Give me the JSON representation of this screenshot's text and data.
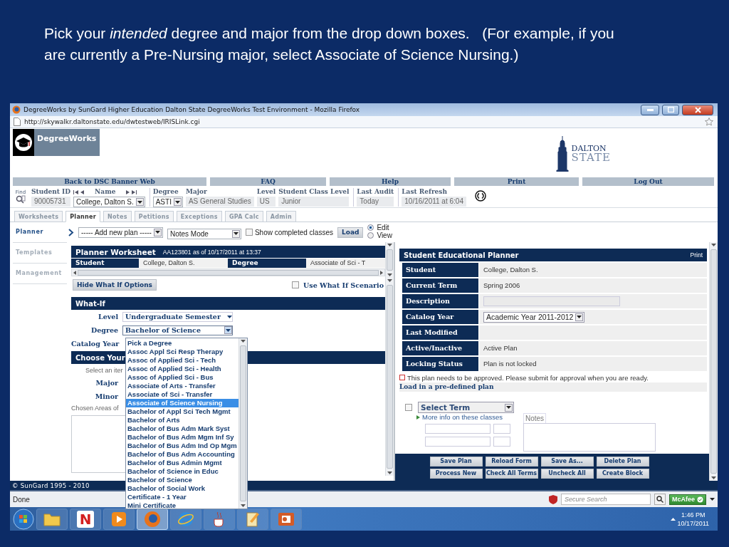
{
  "caption": "Pick your *intended* degree and major from the drop down boxes.   (For example, if you are currently a Pre-Nursing major, select Associate of Science Nursing.)",
  "window": {
    "title": "DegreeWorks by SunGard Higher Education Dalton State DegreeWorks Test Environment - Mozilla Firefox",
    "url": "http://skywalkr.daltonstate.edu/dwtestweb/IRISLink.cgi"
  },
  "header": {
    "logo": "DegreeWorks",
    "school_logo": {
      "top": "DALTON",
      "bottom": "STATE"
    }
  },
  "nav": [
    "Back to DSC Banner Web",
    "FAQ",
    "Help",
    "Print",
    "Log Out"
  ],
  "student_bar": {
    "find": "Find",
    "fields": [
      {
        "kind": "text",
        "label": "Student ID",
        "value": "90005731"
      },
      {
        "kind": "name",
        "label": "Name",
        "value": "College, Dalton S."
      },
      {
        "kind": "select",
        "label": "Degree",
        "value": "ASTI"
      },
      {
        "kind": "text",
        "label": "Major",
        "value": "AS General Studies"
      },
      {
        "kind": "text",
        "label": "Level",
        "value": "US"
      },
      {
        "kind": "text",
        "label": "Student Class Level",
        "value": "Junior"
      },
      {
        "kind": "text",
        "label": "Last Audit",
        "value": "Today"
      },
      {
        "kind": "text",
        "label": "Last Refresh",
        "value": "10/16/2011 at 6:04"
      }
    ]
  },
  "tabs": [
    {
      "label": "Worksheets",
      "selected": false
    },
    {
      "label": "Planner",
      "selected": true
    },
    {
      "label": "Notes",
      "selected": false
    },
    {
      "label": "Petitions",
      "selected": false
    },
    {
      "label": "Exceptions",
      "selected": false
    },
    {
      "label": "GPA Calc",
      "selected": false
    },
    {
      "label": "Admin",
      "selected": false
    }
  ],
  "sidebar": [
    {
      "label": "Planner",
      "selected": true
    },
    {
      "label": "Templates",
      "selected": false
    },
    {
      "label": "Management",
      "selected": false
    }
  ],
  "toolbar": {
    "plan_select": "----- Add new plan -----",
    "mode_select": "Notes Mode",
    "show_completed": {
      "label": "Show completed classes",
      "checked": false
    },
    "load": "Load",
    "modes": [
      {
        "label": "Edit",
        "selected": true
      },
      {
        "label": "View",
        "selected": false
      }
    ]
  },
  "worksheet": {
    "title": "Planner Worksheet",
    "subtitle": "AA123801 as of 10/17/2011 at 13:37",
    "cells": [
      {
        "kind": "head",
        "text": "Student"
      },
      {
        "kind": "value",
        "text": "College, Dalton S."
      },
      {
        "kind": "head",
        "text": "Degree"
      },
      {
        "kind": "value",
        "text": "Associate of Sci - T"
      }
    ]
  },
  "whatif": {
    "hide_button": "Hide What If Options",
    "use_scenario": {
      "label": "Use What If Scenario",
      "checked": false
    },
    "title": "What-If",
    "level": {
      "label": "Level",
      "value": "Undergraduate Semester"
    },
    "degree": {
      "label": "Degree",
      "value": "Bachelor of Science"
    },
    "catalog_year": "Catalog Year",
    "choose_title": "Choose Your",
    "select_hint": "Select an iter",
    "major": "Major",
    "minor": "Minor",
    "chosen_areas": "Chosen Areas of"
  },
  "degree_options": [
    {
      "label": "Pick a Degree",
      "selected": false
    },
    {
      "label": "Assoc Appl Sci Resp Therapy",
      "selected": false
    },
    {
      "label": "Assoc of Applied Sci - Tech",
      "selected": false
    },
    {
      "label": "Assoc of Applied Sci - Health",
      "selected": false
    },
    {
      "label": "Assoc of Applied Sci - Bus",
      "selected": false
    },
    {
      "label": "Associate of Arts - Transfer",
      "selected": false
    },
    {
      "label": "Associate of Sci - Transfer",
      "selected": false
    },
    {
      "label": "Associate of Science Nursing",
      "selected": true
    },
    {
      "label": "Bachelor of Appl Sci Tech Mgmt",
      "selected": false
    },
    {
      "label": "Bachelor of Arts",
      "selected": false
    },
    {
      "label": "Bachelor of Bus Adm Mark Syst",
      "selected": false
    },
    {
      "label": "Bachelor of Bus Adm Mgm Inf Sy",
      "selected": false
    },
    {
      "label": "Bachelor of Bus Adm Ind Op Mgm",
      "selected": false
    },
    {
      "label": "Bachelor of Bus Adm Accounting",
      "selected": false
    },
    {
      "label": "Bachelor of Bus Admin Mgmt",
      "selected": false
    },
    {
      "label": "Bachelor of Science in Educ",
      "selected": false
    },
    {
      "label": "Bachelor of Science",
      "selected": false
    },
    {
      "label": "Bachelor of Social Work",
      "selected": false
    },
    {
      "label": "Certificate - 1 Year",
      "selected": false
    },
    {
      "label": "Mini Certificate",
      "selected": false
    }
  ],
  "planner": {
    "title": "Student Educational Planner",
    "print": "Print",
    "rows": [
      {
        "kind": "text",
        "label": "Student",
        "value": "College, Dalton S."
      },
      {
        "kind": "text",
        "label": "Current Term",
        "value": "Spring 2006"
      },
      {
        "kind": "input",
        "label": "Description"
      },
      {
        "kind": "select",
        "label": "Catalog Year",
        "value": "Academic Year 2011-2012"
      },
      {
        "kind": "text",
        "label": "Last Modified"
      },
      {
        "kind": "text",
        "label": "Active/Inactive",
        "value": "Active Plan"
      },
      {
        "kind": "text",
        "label": "Locking Status",
        "value": "Plan is not locked"
      }
    ],
    "approval_note": "This plan needs to be approved. Please submit for approval when you are ready.",
    "load_title": "Load in a pre-defined plan",
    "term_select": "Select Term",
    "term_checked": false,
    "more_info": "More info on these classes",
    "notes": "Notes"
  },
  "planner_buttons": [
    "Save Plan",
    "Reload Form",
    "Save As...",
    "Delete Plan",
    "Process New",
    "Check All Terms",
    "Uncheck All",
    "Create Block"
  ],
  "footer": "© SunGard 1995 - 2010",
  "status_bar": {
    "text": "Done",
    "search_placeholder": "Secure Search",
    "mcafee": "McAfee"
  },
  "taskbar": {
    "apps": [
      {
        "kind": "folder",
        "selected": false
      },
      {
        "kind": "letter",
        "label": "N",
        "selected": false
      },
      {
        "kind": "media",
        "selected": false
      },
      {
        "kind": "firefox",
        "selected": true
      },
      {
        "kind": "ie",
        "selected": false
      },
      {
        "kind": "java",
        "selected": false
      },
      {
        "kind": "notes",
        "selected": false
      },
      {
        "kind": "presentation",
        "selected": false
      }
    ],
    "time": "1:46 PM",
    "date": "10/17/2011"
  }
}
